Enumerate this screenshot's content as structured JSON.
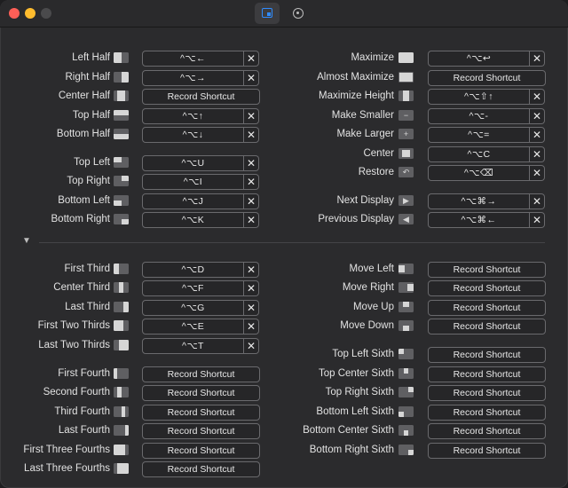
{
  "window": {
    "tabs": [
      "shortcuts-tab",
      "settings-tab"
    ]
  },
  "sections": {
    "left_top": [
      {
        "label": "Left Half",
        "shortcut": "^⌥←",
        "icon": "left-half"
      },
      {
        "label": "Right Half",
        "shortcut": "^⌥→",
        "icon": "right-half"
      },
      {
        "label": "Center Half",
        "shortcut": "",
        "icon": "center-half"
      },
      {
        "label": "Top Half",
        "shortcut": "^⌥↑",
        "icon": "top-half"
      },
      {
        "label": "Bottom Half",
        "shortcut": "^⌥↓",
        "icon": "bottom-half"
      },
      {
        "label": "Top Left",
        "shortcut": "^⌥U",
        "icon": "top-left"
      },
      {
        "label": "Top Right",
        "shortcut": "^⌥I",
        "icon": "top-right"
      },
      {
        "label": "Bottom Left",
        "shortcut": "^⌥J",
        "icon": "bottom-left"
      },
      {
        "label": "Bottom Right",
        "shortcut": "^⌥K",
        "icon": "bottom-right"
      }
    ],
    "right_top": [
      {
        "label": "Maximize",
        "shortcut": "^⌥↩",
        "icon": "maximize"
      },
      {
        "label": "Almost Maximize",
        "shortcut": "",
        "icon": "almost-maximize"
      },
      {
        "label": "Maximize Height",
        "shortcut": "^⌥⇧↑",
        "icon": "maximize-height"
      },
      {
        "label": "Make Smaller",
        "shortcut": "^⌥-",
        "icon": "make-smaller"
      },
      {
        "label": "Make Larger",
        "shortcut": "^⌥=",
        "icon": "make-larger"
      },
      {
        "label": "Center",
        "shortcut": "^⌥C",
        "icon": "center"
      },
      {
        "label": "Restore",
        "shortcut": "^⌥⌫",
        "icon": "restore"
      },
      {
        "label": "Next Display",
        "shortcut": "^⌥⌘→",
        "icon": "next-display"
      },
      {
        "label": "Previous Display",
        "shortcut": "^⌥⌘←",
        "icon": "previous-display"
      }
    ],
    "left_bottom": [
      {
        "label": "First Third",
        "shortcut": "^⌥D",
        "icon": "first-third"
      },
      {
        "label": "Center Third",
        "shortcut": "^⌥F",
        "icon": "center-third"
      },
      {
        "label": "Last Third",
        "shortcut": "^⌥G",
        "icon": "last-third"
      },
      {
        "label": "First Two Thirds",
        "shortcut": "^⌥E",
        "icon": "first-two-thirds"
      },
      {
        "label": "Last Two Thirds",
        "shortcut": "^⌥T",
        "icon": "last-two-thirds"
      },
      {
        "label": "First Fourth",
        "shortcut": "",
        "icon": "first-fourth"
      },
      {
        "label": "Second Fourth",
        "shortcut": "",
        "icon": "second-fourth"
      },
      {
        "label": "Third Fourth",
        "shortcut": "",
        "icon": "third-fourth"
      },
      {
        "label": "Last Fourth",
        "shortcut": "",
        "icon": "last-fourth"
      },
      {
        "label": "First Three Fourths",
        "shortcut": "",
        "icon": "first-three-fourths"
      },
      {
        "label": "Last Three Fourths",
        "shortcut": "",
        "icon": "last-three-fourths"
      }
    ],
    "right_bottom": [
      {
        "label": "Move Left",
        "shortcut": "",
        "icon": "move-left"
      },
      {
        "label": "Move Right",
        "shortcut": "",
        "icon": "move-right"
      },
      {
        "label": "Move Up",
        "shortcut": "",
        "icon": "move-up"
      },
      {
        "label": "Move Down",
        "shortcut": "",
        "icon": "move-down"
      },
      {
        "label": "Top Left Sixth",
        "shortcut": "",
        "icon": "top-left-sixth"
      },
      {
        "label": "Top Center Sixth",
        "shortcut": "",
        "icon": "top-center-sixth"
      },
      {
        "label": "Top Right Sixth",
        "shortcut": "",
        "icon": "top-right-sixth"
      },
      {
        "label": "Bottom Left Sixth",
        "shortcut": "",
        "icon": "bottom-left-sixth"
      },
      {
        "label": "Bottom Center Sixth",
        "shortcut": "",
        "icon": "bottom-center-sixth"
      },
      {
        "label": "Bottom Right Sixth",
        "shortcut": "",
        "icon": "bottom-right-sixth"
      }
    ]
  },
  "record_placeholder": "Record Shortcut",
  "clear_glyph": "✕",
  "disclosure_glyph": "▼",
  "colors": {
    "accent": "#2f8cff",
    "close": "#ff5f57",
    "minimize": "#febc2e"
  }
}
